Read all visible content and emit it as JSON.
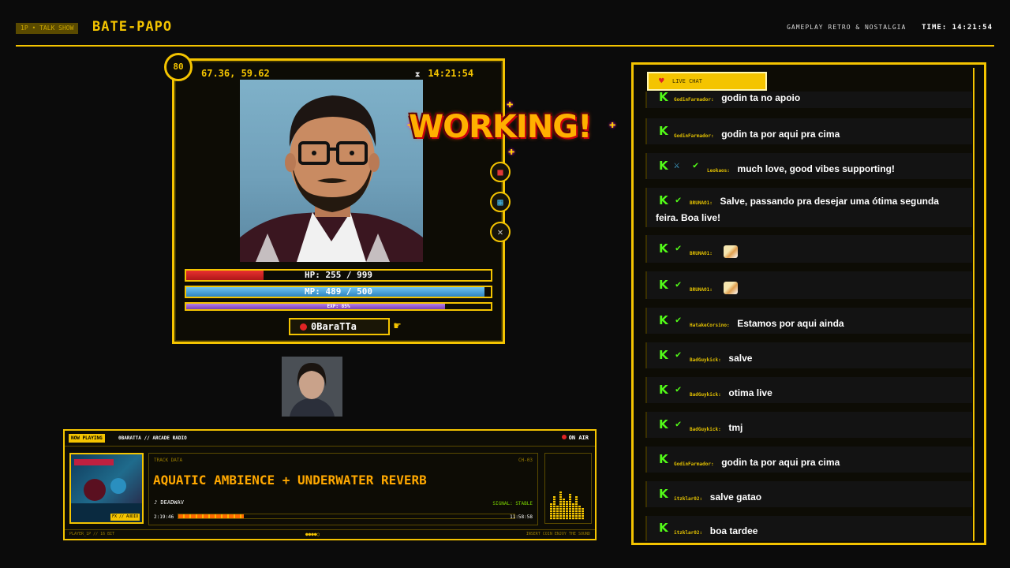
{
  "header": {
    "badge": "1P • TALK SHOW",
    "title": "BATE-PAPO",
    "subtitle": "GAMEPLAY RETRO & NOSTALGIA",
    "time_label": "TIME: 14:21:54"
  },
  "profile": {
    "level": "80",
    "coords": "67.36, 59.62",
    "clock": "14:21:54",
    "hp_label": "HP: 255 / 999",
    "hp_fraction": 0.255,
    "mp_label": "MP: 489 / 500",
    "mp_fraction": 0.978,
    "exp_label": "EXP: 85%",
    "exp_fraction": 0.85,
    "name": "0BaraTTa",
    "status_text": "WORKING!",
    "side_buttons": [
      "backpack-icon",
      "map-icon",
      "swords-icon"
    ]
  },
  "player": {
    "badge": "NOW PLAYING",
    "station": "0BARATTA // ARCADE RADIO",
    "on_air": "ON AIR",
    "cover_tag": "FX // AUDIO",
    "track_label": "TRACK DATA",
    "channel": "CH-03",
    "title": "AQUATIC AMBIENCE + UNDERWATER REVERB",
    "artist": "♪ DEADWAV",
    "signal": "SIGNAL: STABLE",
    "elapsed": "2:19:46",
    "total": "11:58:58",
    "progress": 0.195,
    "footer_left": "PLAYER_1P // 16 BIT",
    "footer_mid": "●●●●○",
    "footer_right": "INSERT COIN     ENJOY THE SOUND",
    "eq_levels": [
      0.35,
      0.5,
      0.3,
      0.6,
      0.45,
      0.4,
      0.55,
      0.35,
      0.5,
      0.3,
      0.25
    ]
  },
  "chat": {
    "tab_label": "LIVE CHAT",
    "messages": [
      {
        "user": "GodinFarmador:",
        "text": "godin ta no apoio"
      },
      {
        "user": "GodinFarmador:",
        "text": "godin ta por aqui pra cima"
      },
      {
        "user": "Leokaos:",
        "text": "much love, good vibes supporting!"
      },
      {
        "user": "BRUNAO1:",
        "text": "Salve, passando pra desejar uma ótima segunda feira. Boa live!"
      },
      {
        "user": "BRUNAO1:",
        "text": ""
      },
      {
        "user": "BRUNAO1:",
        "text": ""
      },
      {
        "user": "HatakeCorsino:",
        "text": "Estamos por aqui ainda"
      },
      {
        "user": "BadGuykick:",
        "text": "salve"
      },
      {
        "user": "BadGuykick:",
        "text": "otima live"
      },
      {
        "user": "BadGuykick:",
        "text": "tmj"
      },
      {
        "user": "GodinFarmador:",
        "text": "godin ta por aqui pra cima"
      },
      {
        "user": "itzklar02:",
        "text": "salve gatao"
      },
      {
        "user": "itzklar02:",
        "text": "boa tardee"
      }
    ]
  },
  "colors": {
    "accent": "#f4c400",
    "kick_green": "#53fc18",
    "hp": "#e83030",
    "mp": "#2d84c0",
    "exp": "#7b3fb5"
  }
}
